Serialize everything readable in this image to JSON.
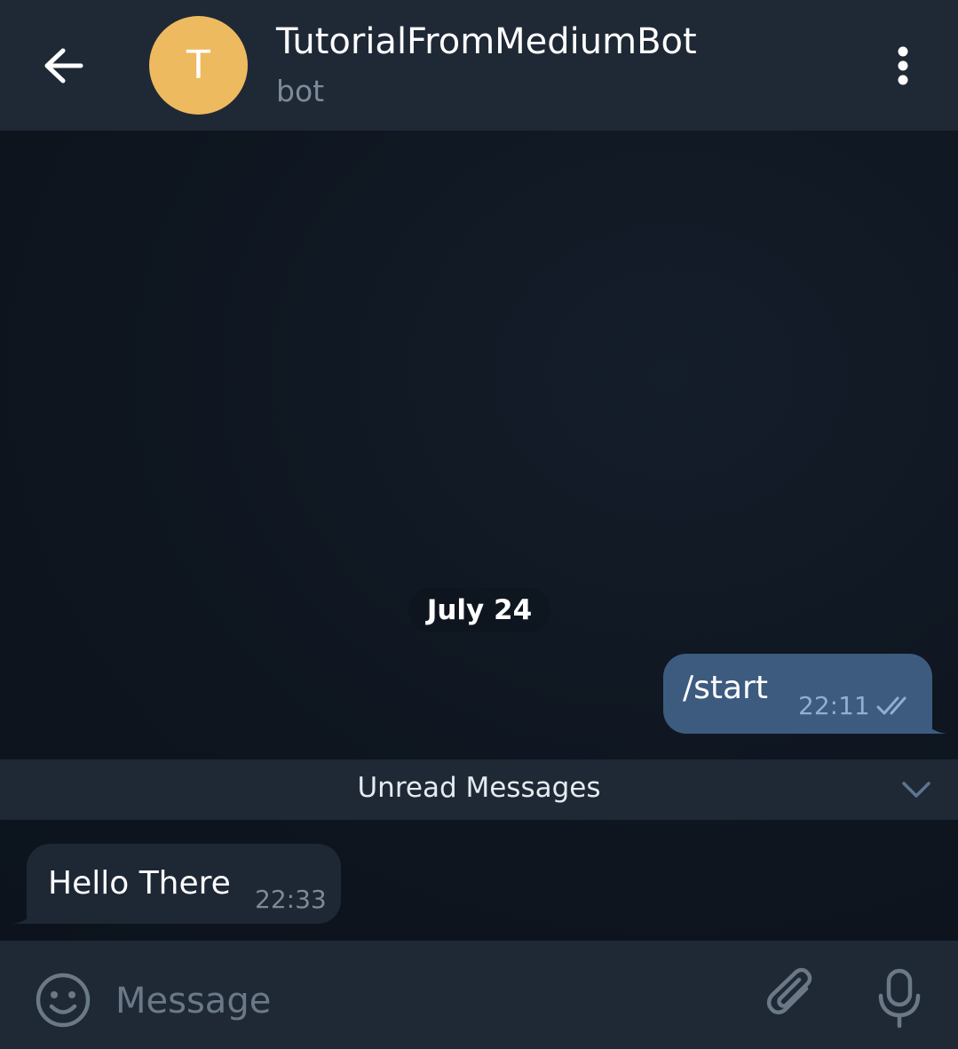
{
  "header": {
    "avatar_letter": "T",
    "title": "TutorialFromMediumBot",
    "subtitle": "bot"
  },
  "chat": {
    "date_separator": "July 24",
    "messages": [
      {
        "direction": "outgoing",
        "text": "/start",
        "time": "22:11",
        "status": "read"
      },
      {
        "direction": "incoming",
        "text": "Hello There",
        "time": "22:33"
      }
    ],
    "unread_label": "Unread Messages"
  },
  "input": {
    "placeholder": "Message"
  },
  "icons": {
    "back": "arrow-left-icon",
    "menu": "more-vertical-icon",
    "emoji": "smiley-icon",
    "attach": "paperclip-icon",
    "mic": "microphone-icon",
    "read_receipt": "double-check-icon",
    "chevron": "chevron-down-icon"
  },
  "colors": {
    "header_bg": "#1f2936",
    "chat_bg": "#0f1621",
    "avatar_bg": "#eeba5f",
    "outgoing_bubble": "#3d5b7f",
    "incoming_bubble": "#1e2734",
    "secondary_text": "#7d8b99"
  }
}
